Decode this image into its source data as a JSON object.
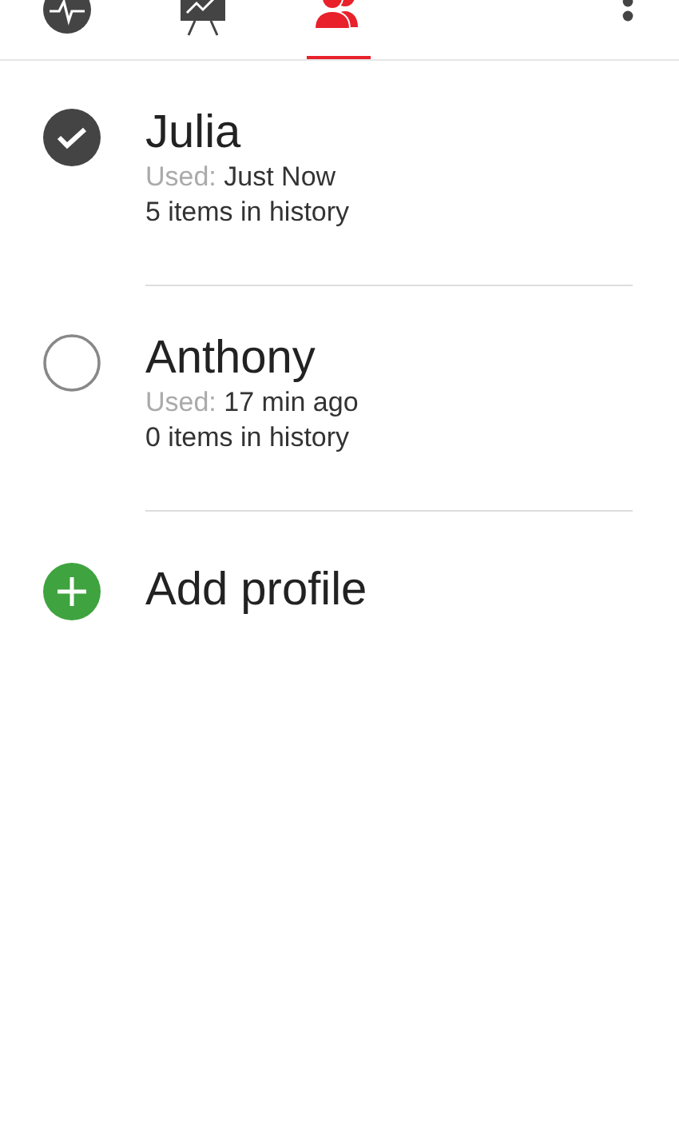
{
  "tabs": [
    {
      "kind": "activity",
      "selected": false
    },
    {
      "kind": "chart",
      "selected": false
    },
    {
      "kind": "profiles",
      "selected": true
    }
  ],
  "profiles": [
    {
      "name": "Julia",
      "used_label": "Used:",
      "used_value": "Just Now",
      "history": "5 items in history",
      "selected": true
    },
    {
      "name": "Anthony",
      "used_label": "Used:",
      "used_value": "17 min ago",
      "history": "0 items in history",
      "selected": false
    }
  ],
  "add_profile": {
    "label": "Add profile"
  }
}
